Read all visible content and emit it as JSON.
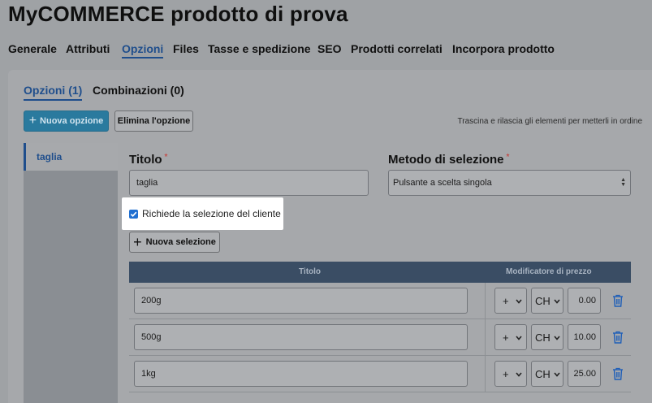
{
  "page": {
    "title": "MyCOMMERCE prodotto di prova"
  },
  "tabs": [
    {
      "label": "Generale"
    },
    {
      "label": "Attributi"
    },
    {
      "label": "Opzioni"
    },
    {
      "label": "Files"
    },
    {
      "label": "Tasse e spedizione"
    },
    {
      "label": "SEO"
    },
    {
      "label": "Prodotti correlati"
    },
    {
      "label": "Incorpora prodotto"
    }
  ],
  "active_tab": "Opzioni",
  "subtabs": [
    {
      "label": "Opzioni (1)"
    },
    {
      "label": "Combinazioni (0)"
    }
  ],
  "toolbar": {
    "new_option": "Nuova opzione",
    "delete_option": "Elimina l'opzione",
    "hint": "Trascina e rilascia gli elementi per metterli in ordine"
  },
  "sidebar": {
    "items": [
      {
        "label": "taglia"
      }
    ]
  },
  "form": {
    "title_label": "Titolo",
    "title_value": "taglia",
    "method_label": "Metodo di selezione",
    "method_value": "Pulsante a scelta singola",
    "required_mark": "*",
    "checkbox_label": "Richiede la selezione del cliente",
    "checkbox_checked": true,
    "new_selection": "Nuova selezione"
  },
  "table": {
    "headers": {
      "title": "Titolo",
      "price_modifier": "Modificatore di prezzo"
    },
    "rows": [
      {
        "title": "200g",
        "sign": "+",
        "currency": "CH",
        "amount": "0.00"
      },
      {
        "title": "500g",
        "sign": "+",
        "currency": "CH",
        "amount": "10.00"
      },
      {
        "title": "1kg",
        "sign": "+",
        "currency": "CH",
        "amount": "25.00"
      }
    ]
  },
  "colors": {
    "accent": "#1f4e8c",
    "primary_button": "#2a7a9e",
    "table_header": "#3a4d64",
    "trash": "#1f5fb8"
  },
  "icons": {
    "add": "plus-icon",
    "delete": "trash-icon",
    "dropdown": "chevron-down-icon"
  }
}
